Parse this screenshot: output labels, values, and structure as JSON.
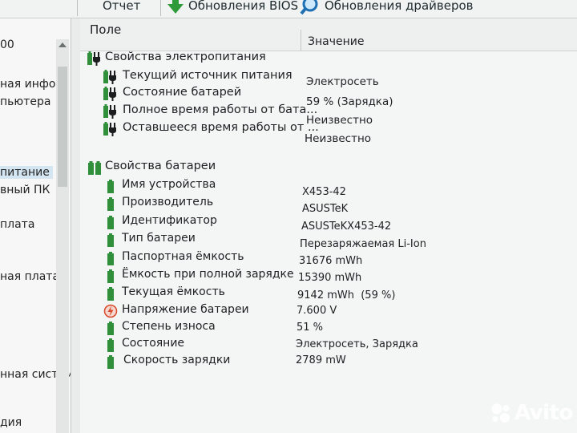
{
  "toolbar": {
    "report_label": "Отчет",
    "bios_label": "Обновления BIOS",
    "drivers_label": "Обновления драйверов"
  },
  "tree": {
    "items": [
      {
        "label": "00"
      },
      {
        "label": "ная инфор"
      },
      {
        "label": "пьютера"
      },
      {
        "label": "питание"
      },
      {
        "label": "вный ПК"
      },
      {
        "label": "плата"
      },
      {
        "label": "ная плата"
      },
      {
        "label": "нная систем"
      },
      {
        "label": "дия"
      }
    ]
  },
  "grid": {
    "col_field": "Поле",
    "col_value": "Значение",
    "power_section": "Свойства электропитания",
    "power_rows": [
      {
        "field": "Текущий источник питания",
        "value": "Электросеть"
      },
      {
        "field": "Состояние батарей",
        "value": "59 % (Зарядка)"
      },
      {
        "field": "Полное время работы от бата...",
        "value": "Неизвестно"
      },
      {
        "field": "Оставшееся время работы от ...",
        "value": "Неизвестно"
      }
    ],
    "battery_section": "Свойства батареи",
    "battery_rows": [
      {
        "field": "Имя устройства",
        "value": "X453-42"
      },
      {
        "field": "Производитель",
        "value": "ASUSTeK"
      },
      {
        "field": "Идентификатор",
        "value": "ASUSTeKX453-42"
      },
      {
        "field": "Тип батареи",
        "value": "Перезаряжаемая Li-Ion"
      },
      {
        "field": "Паспортная ёмкость",
        "value": "31676 mWh"
      },
      {
        "field": "Ёмкость при полной зарядке",
        "value": "15390 mWh"
      },
      {
        "field": "Текущая ёмкость",
        "value": "9142 mWh  (59 %)"
      },
      {
        "field": "Напряжение батареи",
        "value": "7.600 V"
      },
      {
        "field": "Степень износа",
        "value": "51 %"
      },
      {
        "field": "Состояние",
        "value": "Электросеть, Зарядка"
      },
      {
        "field": "Скорость зарядки",
        "value": "2789 mW"
      }
    ]
  },
  "watermark": {
    "text": "Avito"
  },
  "colors": {
    "battery_green": "#2f8f3a",
    "plug_dark": "#1b1e1f",
    "voltage_red": "#d9482a"
  },
  "icons": [
    "report-icon",
    "bios-update-icon",
    "driver-update-icon",
    "battery-plug-icon",
    "battery-icon",
    "voltage-icon",
    "avito-logo"
  ]
}
